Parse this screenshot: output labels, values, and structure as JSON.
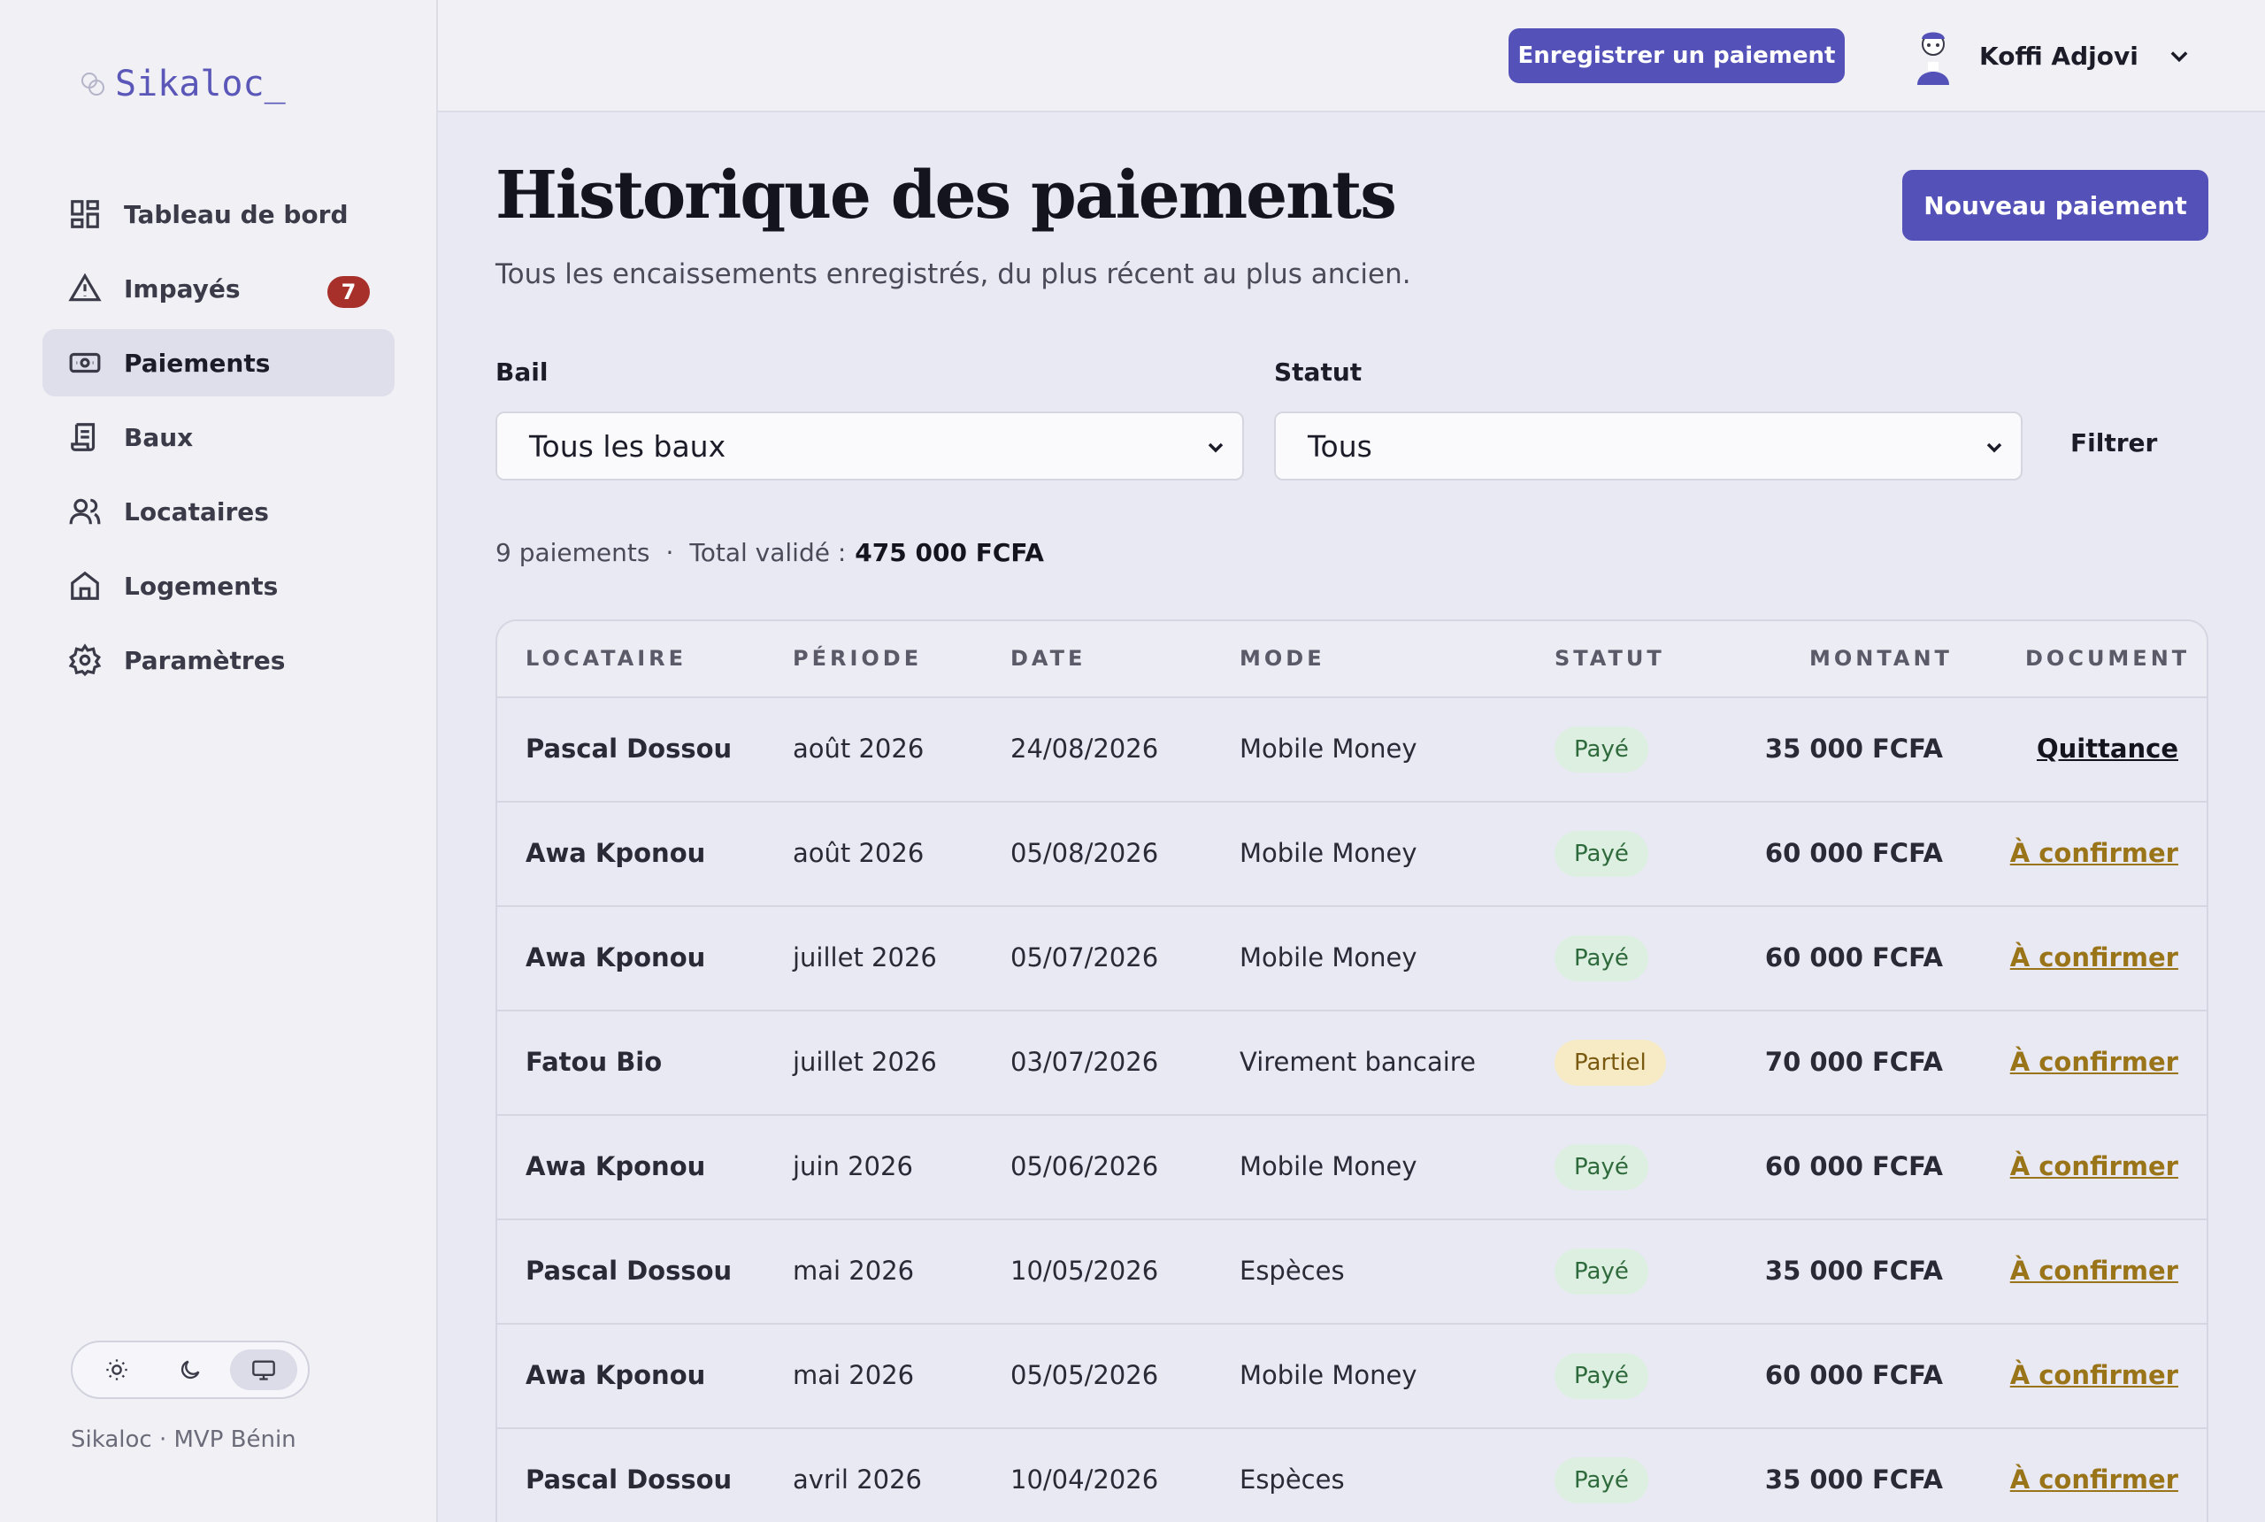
{
  "app": {
    "name": "Sikaloc_",
    "footer": "Sikaloc · MVP Bénin"
  },
  "sidebar": {
    "items": [
      {
        "label": "Tableau de bord",
        "icon": "dashboard-icon"
      },
      {
        "label": "Impayés",
        "icon": "warning-icon",
        "badge": "7"
      },
      {
        "label": "Paiements",
        "icon": "banknote-icon",
        "active": true
      },
      {
        "label": "Baux",
        "icon": "scroll-icon"
      },
      {
        "label": "Locataires",
        "icon": "users-icon"
      },
      {
        "label": "Logements",
        "icon": "home-icon"
      },
      {
        "label": "Paramètres",
        "icon": "gear-icon"
      }
    ],
    "theme": {
      "options": [
        "sun-icon",
        "moon-icon",
        "monitor-icon"
      ],
      "selected": "monitor-icon"
    }
  },
  "header": {
    "record_button": "Enregistrer un paiement",
    "user_name": "Koffi Adjovi"
  },
  "main": {
    "title": "Historique des paiements",
    "subtitle": "Tous les encaissements enregistrés, du plus récent au plus ancien.",
    "new_button": "Nouveau paiement",
    "filters": {
      "bail_label": "Bail",
      "bail_value": "Tous les baux",
      "statut_label": "Statut",
      "statut_value": "Tous",
      "filter_button": "Filtrer"
    },
    "summary": {
      "count": "9 paiements",
      "separator": "·",
      "total_label": "Total validé :",
      "total_value": "475 000 FCFA"
    },
    "table": {
      "headers": [
        "LOCATAIRE",
        "PÉRIODE",
        "DATE",
        "MODE",
        "STATUT",
        "MONTANT",
        "DOCUMENT"
      ],
      "rows": [
        {
          "tenant": "Pascal Dossou",
          "period": "août 2026",
          "date": "24/08/2026",
          "mode": "Mobile Money",
          "status": "Payé",
          "amount": "35 000 FCFA",
          "document": "Quittance"
        },
        {
          "tenant": "Awa Kponou",
          "period": "août 2026",
          "date": "05/08/2026",
          "mode": "Mobile Money",
          "status": "Payé",
          "amount": "60 000 FCFA",
          "document": "À confirmer"
        },
        {
          "tenant": "Awa Kponou",
          "period": "juillet 2026",
          "date": "05/07/2026",
          "mode": "Mobile Money",
          "status": "Payé",
          "amount": "60 000 FCFA",
          "document": "À confirmer"
        },
        {
          "tenant": "Fatou Bio",
          "period": "juillet 2026",
          "date": "03/07/2026",
          "mode": "Virement bancaire",
          "status": "Partiel",
          "amount": "70 000 FCFA",
          "document": "À confirmer"
        },
        {
          "tenant": "Awa Kponou",
          "period": "juin 2026",
          "date": "05/06/2026",
          "mode": "Mobile Money",
          "status": "Payé",
          "amount": "60 000 FCFA",
          "document": "À confirmer"
        },
        {
          "tenant": "Pascal Dossou",
          "period": "mai 2026",
          "date": "10/05/2026",
          "mode": "Espèces",
          "status": "Payé",
          "amount": "35 000 FCFA",
          "document": "À confirmer"
        },
        {
          "tenant": "Awa Kponou",
          "period": "mai 2026",
          "date": "05/05/2026",
          "mode": "Mobile Money",
          "status": "Payé",
          "amount": "60 000 FCFA",
          "document": "À confirmer"
        },
        {
          "tenant": "Pascal Dossou",
          "period": "avril 2026",
          "date": "10/04/2026",
          "mode": "Espèces",
          "status": "Payé",
          "amount": "35 000 FCFA",
          "document": "À confirmer"
        }
      ]
    }
  },
  "colors": {
    "accent": "#5452b8",
    "badge": "#a8302a",
    "paid_bg": "#dcefe0",
    "partial_bg": "#f7ebc6",
    "confirm_link": "#9a7418"
  }
}
